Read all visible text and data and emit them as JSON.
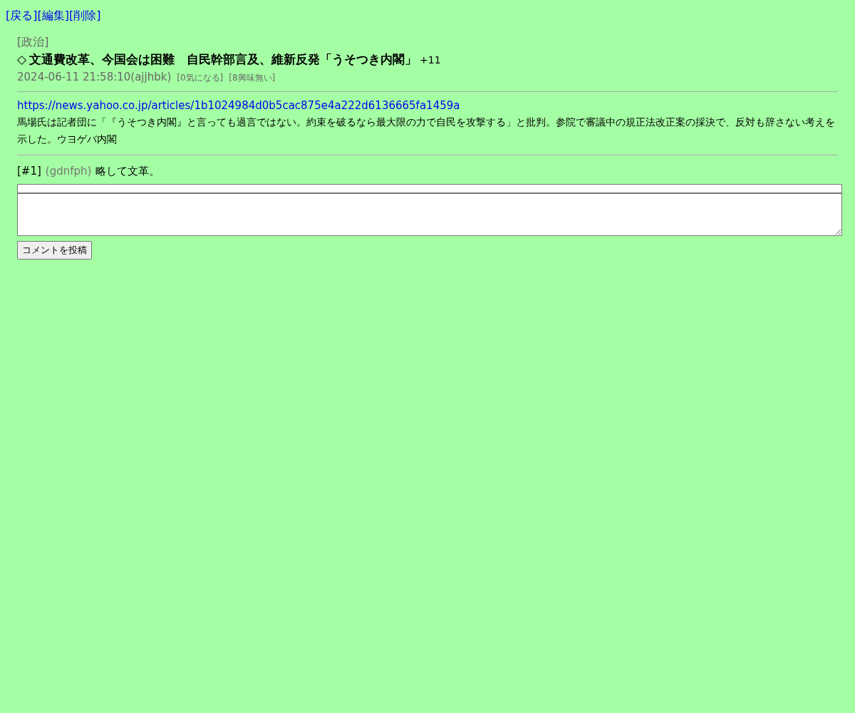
{
  "nav_links": [
    "[戻る]",
    "[編集]",
    "[削除]"
  ],
  "post": {
    "category": "[政治]",
    "title_mark": "◇",
    "title": "文通費改革、今国会は困難　自民幹部言及、維新反発「うそつき内閣」",
    "score": "+11",
    "meta": "2024-06-11 21:58:10(ajjhbk)",
    "reactions": [
      "[0気になる]",
      "[8興味無い]"
    ],
    "url": "https://news.yahoo.co.jp/articles/1b1024984d0b5cac875e4a222d6136665fa1459a",
    "body": "馬場氏は記者団に「『うそつき内閣』と言っても過言ではない。約束を破るなら最大限の力で自民を攻撃する」と批判。参院で審議中の規正法改正案の採決で、反対も辞さない考えを示した。ウヨゲバ内閣"
  },
  "comments": [
    {
      "number": "[#1]",
      "user": "(gdnfph)",
      "text": "略して文革。"
    }
  ],
  "form": {
    "submit": "コメントを投稿"
  }
}
